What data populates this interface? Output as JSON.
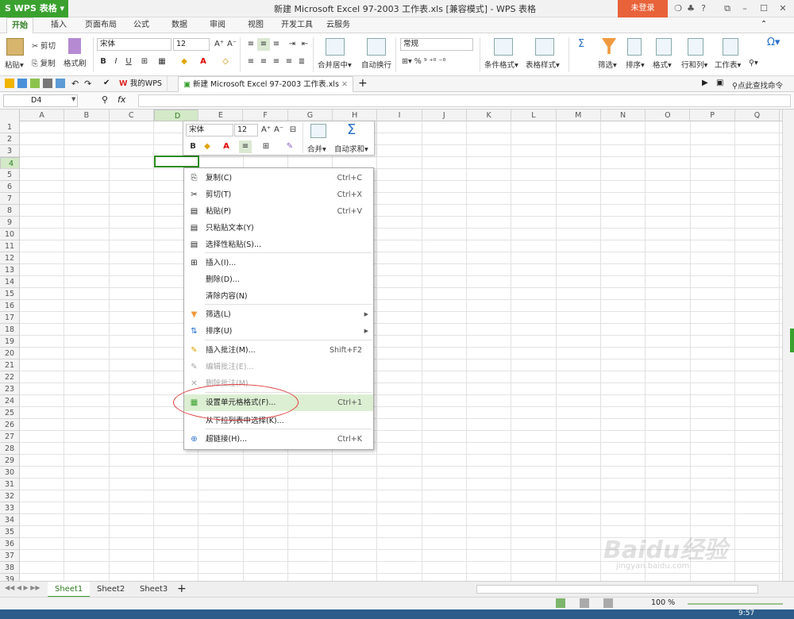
{
  "app": {
    "name": "WPS 表格",
    "window_title": "新建 Microsoft Excel 97-2003 工作表.xls [兼容模式] - WPS 表格",
    "login": "未登录"
  },
  "menu_tabs": [
    "开始",
    "插入",
    "页面布局",
    "公式",
    "数据",
    "审阅",
    "视图",
    "开发工具",
    "云服务"
  ],
  "ribbon": {
    "paste": "粘贴",
    "cut": "剪切",
    "copy": "复制",
    "format_painter": "格式刷",
    "font_name": "宋体",
    "font_size": "12",
    "merge_center": "合并居中",
    "wrap_text": "自动换行",
    "number_format": "常规",
    "conditional_format": "条件格式",
    "table_style": "表格样式",
    "sum_symbol": "Σ",
    "filter": "筛选",
    "sort": "排序",
    "format": "格式",
    "rows_cols": "行和列",
    "worksheet": "工作表",
    "find": "查找"
  },
  "doc_tabs": [
    "我的WPS",
    "新建 Microsoft Excel 97-2003 工作表.xls"
  ],
  "quick_search": "点此查找命令",
  "formula_bar": {
    "name_box": "D4",
    "fx": "fx"
  },
  "columns": [
    "A",
    "B",
    "C",
    "D",
    "E",
    "F",
    "G",
    "H",
    "I",
    "J",
    "K",
    "L",
    "M",
    "N",
    "O",
    "P",
    "Q"
  ],
  "rows": [
    "1",
    "2",
    "3",
    "4",
    "5",
    "6",
    "7",
    "8",
    "9",
    "10",
    "11",
    "12",
    "13",
    "14",
    "15",
    "16",
    "17",
    "18",
    "19",
    "20",
    "21",
    "22",
    "23",
    "24",
    "25",
    "26",
    "27",
    "28",
    "29",
    "30",
    "31",
    "32",
    "33",
    "34",
    "35",
    "36",
    "37",
    "38",
    "39"
  ],
  "mini_toolbar": {
    "font_name": "宋体",
    "font_size": "12",
    "merge": "合并",
    "autosum": "自动求和"
  },
  "context_menu": [
    {
      "label": "复制(C)",
      "shortcut": "Ctrl+C",
      "icon": "copy-icon"
    },
    {
      "label": "剪切(T)",
      "shortcut": "Ctrl+X",
      "icon": "scissors-icon"
    },
    {
      "label": "粘贴(P)",
      "shortcut": "Ctrl+V",
      "icon": "paste-icon"
    },
    {
      "label": "只粘贴文本(Y)",
      "shortcut": "",
      "icon": "paste-text-icon"
    },
    {
      "label": "选择性粘贴(S)...",
      "shortcut": "",
      "icon": "paste-special-icon"
    },
    {
      "label": "插入(I)...",
      "shortcut": "",
      "icon": "insert-icon"
    },
    {
      "label": "删除(D)...",
      "shortcut": "",
      "icon": ""
    },
    {
      "label": "清除内容(N)",
      "shortcut": "",
      "icon": ""
    },
    {
      "label": "筛选(L)",
      "shortcut": "",
      "icon": "filter-icon"
    },
    {
      "label": "排序(U)",
      "shortcut": "",
      "icon": "sort-icon"
    },
    {
      "label": "插入批注(M)...",
      "shortcut": "Shift+F2",
      "icon": "comment-icon"
    },
    {
      "label": "编辑批注(E)...",
      "shortcut": "",
      "icon": "edit-comment-icon"
    },
    {
      "label": "删除批注(M)",
      "shortcut": "",
      "icon": "delete-comment-icon"
    },
    {
      "label": "设置单元格格式(F)...",
      "shortcut": "Ctrl+1",
      "icon": "format-cells-icon"
    },
    {
      "label": "从下拉列表中选择(K)...",
      "shortcut": "",
      "icon": ""
    },
    {
      "label": "超链接(H)...",
      "shortcut": "Ctrl+K",
      "icon": "hyperlink-icon"
    }
  ],
  "sheets": [
    "Sheet1",
    "Sheet2",
    "Sheet3"
  ],
  "status": {
    "zoom": "100 %",
    "time": "9:57"
  },
  "watermark": {
    "logo": "Baidu经验",
    "url": "jingyan.baidu.com"
  },
  "colors": {
    "accent": "#3aa12f",
    "login": "#e8623a",
    "highlight": "#dcefd2",
    "circle": "#e03a3a"
  }
}
